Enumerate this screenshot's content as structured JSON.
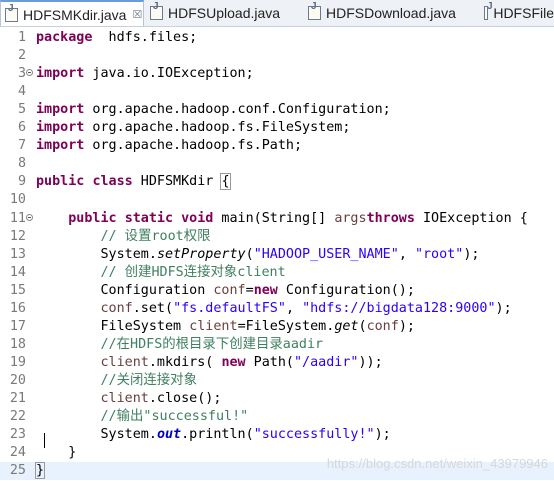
{
  "tabs": [
    {
      "name": "HDFSMKdir.java",
      "active": true,
      "close": "☒"
    },
    {
      "name": "HDFSUpload.java",
      "active": false
    },
    {
      "name": "HDFSDownload.java",
      "active": false
    },
    {
      "name": "HDFSFile",
      "active": false
    }
  ],
  "lines": [
    {
      "n": "1",
      "seg": [
        [
          "kw",
          "package"
        ],
        [
          "",
          "  hdfs.files;"
        ]
      ]
    },
    {
      "n": "2",
      "seg": []
    },
    {
      "n": "3",
      "fold": true,
      "seg": [
        [
          "kw",
          "import"
        ],
        [
          "",
          " java.io.IOException;"
        ]
      ]
    },
    {
      "n": "4",
      "seg": []
    },
    {
      "n": "5",
      "seg": [
        [
          "kw",
          "import"
        ],
        [
          "",
          " org.apache.hadoop.conf.Configuration;"
        ]
      ]
    },
    {
      "n": "6",
      "seg": [
        [
          "kw",
          "import"
        ],
        [
          "",
          " org.apache.hadoop.fs.FileSystem;"
        ]
      ]
    },
    {
      "n": "7",
      "seg": [
        [
          "kw",
          "import"
        ],
        [
          "",
          " org.apache.hadoop.fs.Path;"
        ]
      ]
    },
    {
      "n": "8",
      "seg": []
    },
    {
      "n": "9",
      "seg": [
        [
          "kw",
          "public"
        ],
        [
          "",
          " "
        ],
        [
          "kw",
          "class"
        ],
        [
          "",
          " HDFSMKdir "
        ],
        [
          "brace",
          "{"
        ]
      ]
    },
    {
      "n": "10",
      "seg": []
    },
    {
      "n": "11",
      "fold": true,
      "seg": [
        [
          "",
          "    "
        ],
        [
          "kw",
          "public"
        ],
        [
          "",
          " "
        ],
        [
          "kw",
          "static"
        ],
        [
          "",
          " "
        ],
        [
          "kw",
          "void"
        ],
        [
          "",
          " main(String[] "
        ],
        [
          "var",
          "args"
        ],
        [
          ") "
        ],
        [
          "kw",
          "throws"
        ],
        [
          "",
          " IOException {"
        ]
      ]
    },
    {
      "n": "12",
      "seg": [
        [
          "",
          "        "
        ],
        [
          "cm",
          "// 设置root权限"
        ]
      ]
    },
    {
      "n": "13",
      "seg": [
        [
          "",
          "        System."
        ],
        [
          "ita",
          "setProperty"
        ],
        [
          "",
          "("
        ],
        [
          "str",
          "\"HADOOP_USER_NAME\""
        ],
        [
          "",
          ", "
        ],
        [
          "str",
          "\"root\""
        ],
        [
          "",
          ");"
        ]
      ]
    },
    {
      "n": "14",
      "seg": [
        [
          "",
          "        "
        ],
        [
          "cm",
          "// 创建HDFS连接对象client"
        ]
      ]
    },
    {
      "n": "15",
      "seg": [
        [
          "",
          "        Configuration "
        ],
        [
          "var",
          "conf"
        ],
        [
          "",
          "="
        ],
        [
          "kw",
          "new"
        ],
        [
          "",
          " Configuration();"
        ]
      ]
    },
    {
      "n": "16",
      "seg": [
        [
          "",
          "        "
        ],
        [
          "var",
          "conf"
        ],
        [
          "",
          ".set("
        ],
        [
          "str",
          "\"fs.defaultFS\""
        ],
        [
          "",
          ", "
        ],
        [
          "str",
          "\"hdfs://bigdata128:9000\""
        ],
        [
          "",
          ");"
        ]
      ]
    },
    {
      "n": "17",
      "seg": [
        [
          "",
          "        FileSystem "
        ],
        [
          "var",
          "client"
        ],
        [
          "",
          "=FileSystem."
        ],
        [
          "ita",
          "get"
        ],
        [
          "",
          "("
        ],
        [
          "var",
          "conf"
        ],
        [
          "",
          ");"
        ]
      ]
    },
    {
      "n": "18",
      "seg": [
        [
          "",
          "        "
        ],
        [
          "cm",
          "//在HDFS的根目录下创建目录aadir"
        ]
      ]
    },
    {
      "n": "19",
      "seg": [
        [
          "",
          "        "
        ],
        [
          "var",
          "client"
        ],
        [
          "",
          ".mkdirs( "
        ],
        [
          "kw",
          "new"
        ],
        [
          "",
          " Path("
        ],
        [
          "str",
          "\"/aadir\""
        ],
        [
          "",
          "));"
        ]
      ]
    },
    {
      "n": "20",
      "seg": [
        [
          "",
          "        "
        ],
        [
          "cm",
          "//关闭连接对象"
        ]
      ]
    },
    {
      "n": "21",
      "seg": [
        [
          "",
          "        "
        ],
        [
          "var",
          "client"
        ],
        [
          "",
          ".close();"
        ]
      ]
    },
    {
      "n": "22",
      "seg": [
        [
          "",
          "        "
        ],
        [
          "cm",
          "//输出\"successful!\""
        ]
      ]
    },
    {
      "n": "23",
      "seg": [
        [
          "",
          "        System."
        ],
        [
          "fld",
          "out"
        ],
        [
          "",
          ".println("
        ],
        [
          "str",
          "\"successfully!\""
        ],
        [
          "",
          ");"
        ]
      ]
    },
    {
      "n": "24",
      "seg": [
        [
          "",
          "    }"
        ]
      ]
    },
    {
      "n": "25",
      "cur": true,
      "seg": [
        [
          "brace",
          "}"
        ]
      ]
    }
  ],
  "watermark": "https://blog.csdn.net/weixin_43979946"
}
